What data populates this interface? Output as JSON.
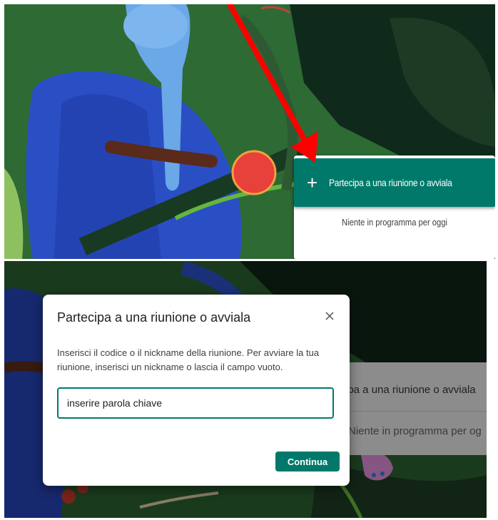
{
  "top_panel": {
    "join_button": {
      "icon": "plus-icon",
      "label": "Partecipa a una riunione o avviala"
    },
    "empty_schedule_text": "Niente in programma per oggi",
    "annotation_arrow": {
      "icon": "red-arrow-icon",
      "color": "#ff0000"
    }
  },
  "bottom_panel": {
    "background_card": {
      "join_label_fragment": "ipa a una riunione o avviala",
      "empty_text_fragment": "Niente in programma per og"
    },
    "dialog": {
      "title": "Partecipa a una riunione o avviala",
      "close_icon": "close-icon",
      "description": "Inserisci il codice o il nickname della riunione. Per avviare la tua riunione, inserisci un nickname o lascia il campo vuoto.",
      "input_value": "inserire parola chiave",
      "continue_label": "Continua"
    }
  },
  "colors": {
    "accent": "#00796b",
    "arrow": "#ff0000"
  }
}
